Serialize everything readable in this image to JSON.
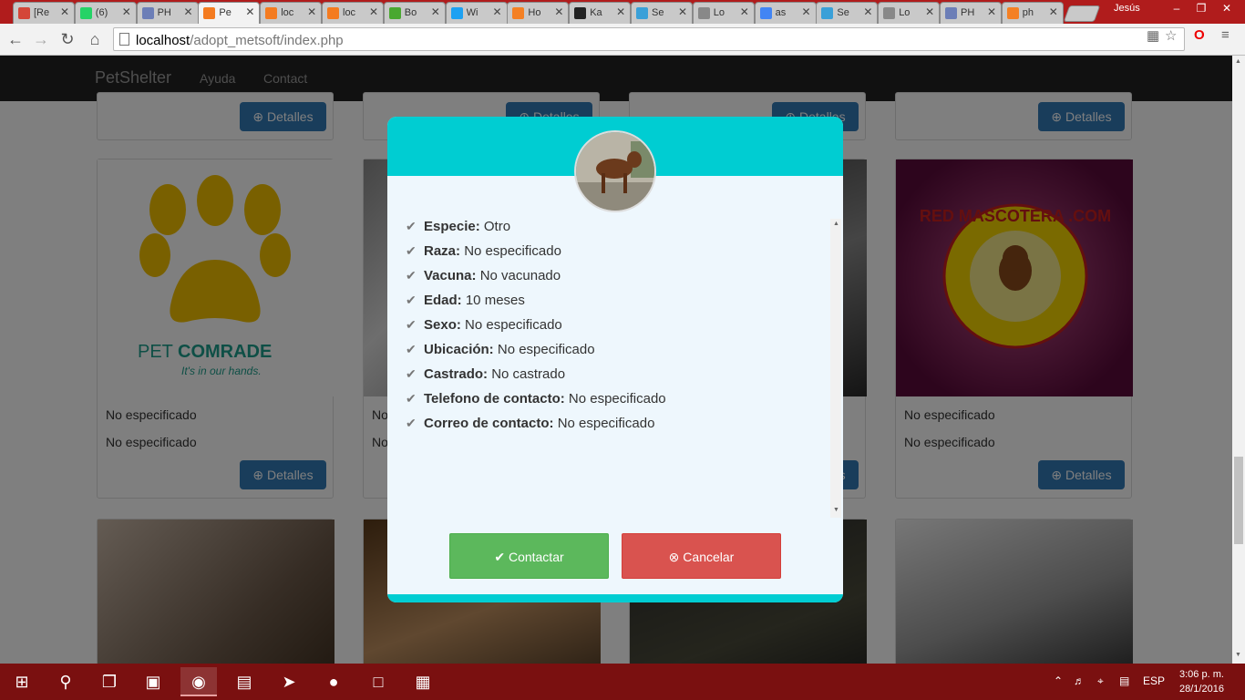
{
  "browser": {
    "tabs": [
      {
        "label": "[Re",
        "favicon": "gmail-icon",
        "color": "#d44638"
      },
      {
        "label": "(6)",
        "favicon": "whatsapp-icon",
        "color": "#25d366"
      },
      {
        "label": "PH",
        "favicon": "php-icon",
        "color": "#6c7eb7"
      },
      {
        "label": "Pe",
        "favicon": "xampp-icon",
        "color": "#f47b20"
      },
      {
        "label": "loc",
        "favicon": "xampp-icon",
        "color": "#f47b20"
      },
      {
        "label": "loc",
        "favicon": "xampp-icon",
        "color": "#f47b20"
      },
      {
        "label": "Bo",
        "favicon": "bootsnipp-icon",
        "color": "#49a830"
      },
      {
        "label": "Wi",
        "favicon": "twitter-icon",
        "color": "#1da1f2"
      },
      {
        "label": "Ho",
        "favicon": "stackoverflow-icon",
        "color": "#f48024"
      },
      {
        "label": "Ka",
        "favicon": "github-icon",
        "color": "#222222"
      },
      {
        "label": "Se",
        "favicon": "colorful-icon",
        "color": "#3aa0d8"
      },
      {
        "label": "Lo",
        "favicon": "page-icon",
        "color": "#888888"
      },
      {
        "label": "as",
        "favicon": "google-icon",
        "color": "#4285f4"
      },
      {
        "label": "Se",
        "favicon": "colorful-icon",
        "color": "#3aa0d8"
      },
      {
        "label": "Lo",
        "favicon": "page-icon",
        "color": "#888888"
      },
      {
        "label": "PH",
        "favicon": "php-icon",
        "color": "#6c7eb7"
      },
      {
        "label": "ph",
        "favicon": "stackoverflow-icon",
        "color": "#f48024"
      }
    ],
    "active_tab_index": 3,
    "user": "Jesús",
    "url_host": "localhost",
    "url_path": "/adopt_metsoft/index.php"
  },
  "site": {
    "brand": "PetShelter",
    "nav": [
      "Ayuda",
      "Contact"
    ],
    "details_label": "Detalles",
    "card_unspecified": "No especificado",
    "card_unspecified_short": "No"
  },
  "modal": {
    "fields": [
      {
        "label": "Especie:",
        "value": "Otro"
      },
      {
        "label": "Raza:",
        "value": "No especificado"
      },
      {
        "label": "Vacuna:",
        "value": "No vacunado"
      },
      {
        "label": "Edad:",
        "value": "10 meses"
      },
      {
        "label": "Sexo:",
        "value": "No especificado"
      },
      {
        "label": "Ubicación:",
        "value": "No especificado"
      },
      {
        "label": "Castrado:",
        "value": "No castrado"
      },
      {
        "label": "Telefono de contacto:",
        "value": "No especificado"
      },
      {
        "label": "Correo de contacto:",
        "value": "No especificado"
      }
    ],
    "contact_label": "Contactar",
    "cancel_label": "Cancelar",
    "header_color": "#00cdd2"
  },
  "logos": {
    "petcomrade_pet": "PET",
    "petcomrade_comrade": "COMRADE",
    "petcomrade_tagline": "It's in our hands.",
    "redmascotera": "RED MASCOTERA .COM"
  },
  "taskbar": {
    "language": "ESP",
    "time": "3:06 p. m.",
    "date": "28/1/2016"
  }
}
